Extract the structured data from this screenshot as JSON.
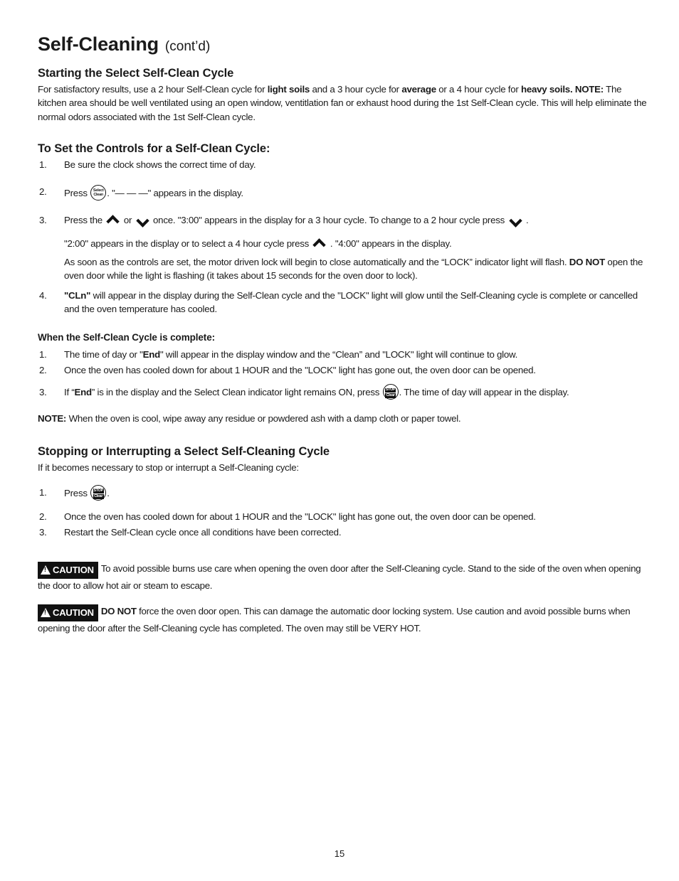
{
  "document": {
    "title_main": "Self-Cleaning",
    "title_cont": "(cont’d)",
    "page_number": "15"
  },
  "section_start": {
    "heading": "Starting the Select Self-Clean Cycle",
    "para_1a": "For satisfactory results, use a 2 hour Self-Clean cycle for ",
    "para_1b": "light soils",
    "para_1c": " and a 3 hour cycle for ",
    "para_1d": "average",
    "para_1e": " or a 4 hour cycle for ",
    "para_1f": "heavy soils. NOTE:",
    "para_1g": " The kitchen area should be well ventilated using an open window, ventitlation fan or exhaust hood during the 1st Self-Clean cycle. This will help eliminate the normal odors associated with the 1st Self-Clean cycle."
  },
  "section_controls": {
    "heading": "To Set the Controls for a Self-Clean Cycle:",
    "steps": [
      {
        "num": "1.",
        "text": "Be sure the clock shows the correct time of day."
      },
      {
        "num": "2.",
        "pre": "Press ",
        "button": {
          "line1": "Select",
          "line2": "Clean"
        },
        "post": ". \"— — —\" appears in the display."
      },
      {
        "num": "3.",
        "t1": "Press the ",
        "arrow_up": "chevron-up",
        "t2": " or ",
        "arrow_down": "chevron-down",
        "t3": " once. \"3:00\" appears in the display for a 3 hour cycle. To change to a 2 hour cycle press ",
        "arrow_down_2": "chevron-down",
        "t4": " ."
      },
      {
        "num": "4.",
        "b1": "\"CLn\"",
        "t1": " will appear in the display during the Self-Clean cycle and the \"LOCK\" light will glow until the Self-Cleaning cycle is complete or cancelled and the oven temperature has cooled."
      }
    ],
    "sub_para_3a": "\"2:00\" appears in the display or to select a 4 hour cycle press ",
    "sub_para_3b": " . \"4:00\" appears in the display.",
    "sub_para_lock": "As soon as the controls are set, the motor driven lock will begin to close automatically and the “LOCK” indicator light will flash. ",
    "sub_para_lock_b": "DO NOT",
    "sub_para_lock_c": " open the oven door while the light is flashing (it takes about 15 seconds for the oven door to lock)."
  },
  "section_complete": {
    "heading": "When the Self-Clean Cycle is complete:",
    "steps": [
      {
        "num": "1.",
        "pre": "The time of day  or \"",
        "bold": "End",
        "post": "\" will appear in the display window and the “Clean” and \"LOCK\" light will continue to glow."
      },
      {
        "num": "2.",
        "text": "Once the oven has cooled down for about 1 HOUR and the \"LOCK\" light has gone out, the oven door can be opened."
      },
      {
        "num": "3.",
        "pre": "If “",
        "bold": "End",
        "mid": "” is in the display and the Select Clean indicator light remains ON, press ",
        "button": {
          "line1": "STOP",
          "line2": "Clear"
        },
        "post": ".  The time of day will appear in the display."
      }
    ],
    "note_label": "NOTE:",
    "note_text": " When the oven is cool, wipe away any residue or powdered ash with a damp cloth or paper towel."
  },
  "section_stopping": {
    "heading": "Stopping or Interrupting a Select Self-Cleaning Cycle",
    "intro": "If it becomes necessary to stop or interrupt a Self-Cleaning cycle:",
    "steps": [
      {
        "num": "1.",
        "pre": "Press ",
        "button": {
          "line1": "STOP",
          "line2": "Clear"
        },
        "post": "."
      },
      {
        "num": "2.",
        "text": "Once the oven has cooled down for about 1 HOUR and the \"LOCK\" light has gone out, the oven door can be opened."
      },
      {
        "num": "3.",
        "text": "Restart the Self-Clean cycle once all conditions have been corrected."
      }
    ]
  },
  "cautions": [
    {
      "badge": "CAUTION",
      "bold_lead": "",
      "text": "To avoid possible burns use care when opening the oven door after the Self-Cleaning cycle. Stand to the side of the oven when opening the door to allow hot air or steam to escape."
    },
    {
      "badge": "CAUTION",
      "bold_lead": "DO NOT",
      "text": " force the oven door open. This can damage the automatic door locking system. Use caution and avoid possible burns when opening the door after the Self-Cleaning cycle has completed. The oven may still be VERY HOT."
    }
  ],
  "colors": {
    "text": "#1a1a1a",
    "caution_badge_bg": "#111111",
    "caution_badge_fg": "#ffffff",
    "page_bg": "#ffffff"
  }
}
